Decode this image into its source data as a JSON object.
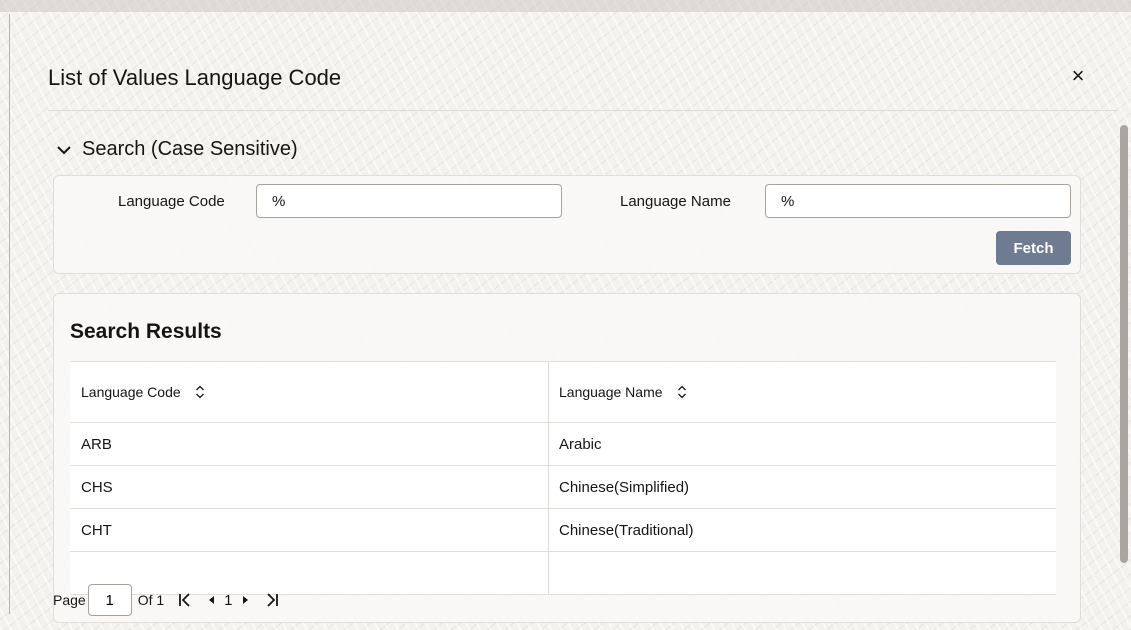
{
  "dialog": {
    "title": "List of Values Language Code",
    "close_symbol": "×"
  },
  "search": {
    "section_title": "Search (Case Sensitive)",
    "fields": [
      {
        "label": "Language Code",
        "value": "%"
      },
      {
        "label": "Language Name",
        "value": "%"
      }
    ],
    "fetch_label": "Fetch"
  },
  "results": {
    "title": "Search Results",
    "columns": [
      "Language Code",
      "Language Name"
    ],
    "rows": [
      [
        "ARB",
        "Arabic"
      ],
      [
        "CHS",
        "Chinese(Simplified)"
      ],
      [
        "CHT",
        "Chinese(Traditional)"
      ]
    ]
  },
  "pagination": {
    "page_label": "Page",
    "current_page": "1",
    "of_label": "Of 1",
    "page_number": "1"
  },
  "icons": {
    "close": "close-icon",
    "section_toggle": "chevron-down-icon",
    "sort": "sort-icon",
    "first": "first-page-icon",
    "prev": "previous-page-icon",
    "next": "next-page-icon",
    "last": "last-page-icon"
  },
  "colors": {
    "fetch_button": "#6f7b90",
    "page_background": "#f4f2ef"
  }
}
